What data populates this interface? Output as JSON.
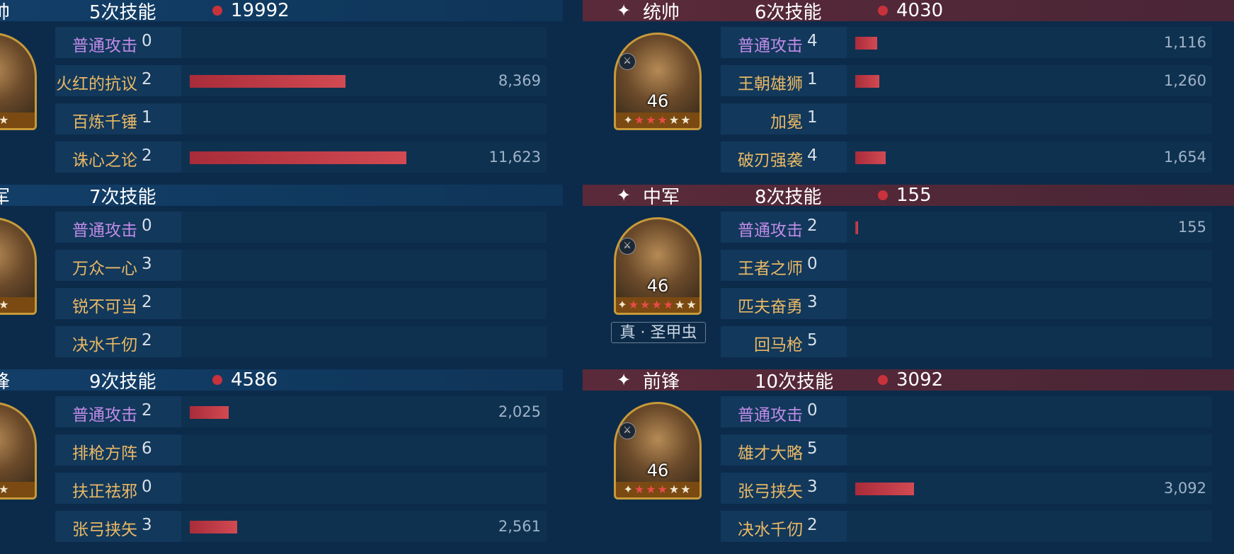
{
  "left": {
    "groups": [
      {
        "role": "帅",
        "count": "5次技能",
        "damage": "19992",
        "show_dot": true,
        "portrait_stars": "★★★",
        "skills": [
          {
            "name": "普通攻击",
            "count": "0",
            "basic": true,
            "damage": "",
            "bar": 0
          },
          {
            "name": "火红的抗议",
            "count": "2",
            "basic": false,
            "damage": "8,369",
            "bar": 0.72
          },
          {
            "name": "百炼千锤",
            "count": "1",
            "basic": false,
            "damage": "",
            "bar": 0
          },
          {
            "name": "诛心之论",
            "count": "2",
            "basic": false,
            "damage": "11,623",
            "bar": 1.0
          }
        ]
      },
      {
        "role": "军",
        "count": "7次技能",
        "damage": "",
        "show_dot": false,
        "portrait_stars": "★★★",
        "skills": [
          {
            "name": "普通攻击",
            "count": "0",
            "basic": true,
            "damage": "",
            "bar": 0
          },
          {
            "name": "万众一心",
            "count": "3",
            "basic": false,
            "damage": "",
            "bar": 0
          },
          {
            "name": "锐不可当",
            "count": "2",
            "basic": false,
            "damage": "",
            "bar": 0
          },
          {
            "name": "决水千仞",
            "count": "2",
            "basic": false,
            "damage": "",
            "bar": 0
          }
        ]
      },
      {
        "role": "锋",
        "count": "9次技能",
        "damage": "4586",
        "show_dot": true,
        "portrait_stars": "★★★",
        "skills": [
          {
            "name": "普通攻击",
            "count": "2",
            "basic": true,
            "damage": "2,025",
            "bar": 0.18
          },
          {
            "name": "排枪方阵",
            "count": "6",
            "basic": false,
            "damage": "",
            "bar": 0
          },
          {
            "name": "扶正祛邪",
            "count": "0",
            "basic": false,
            "damage": "",
            "bar": 0
          },
          {
            "name": "张弓挟矢",
            "count": "3",
            "basic": false,
            "damage": "2,561",
            "bar": 0.22
          }
        ]
      }
    ]
  },
  "right": {
    "groups": [
      {
        "role": "统帅",
        "count": "6次技能",
        "damage": "4030",
        "show_dot": true,
        "level": "46",
        "portrait_stars": "★★★★★",
        "skills": [
          {
            "name": "普通攻击",
            "count": "4",
            "basic": true,
            "damage": "1,116",
            "bar": 0.1
          },
          {
            "name": "王朝雄狮",
            "count": "1",
            "basic": false,
            "damage": "1,260",
            "bar": 0.11
          },
          {
            "name": "加冕",
            "count": "1",
            "basic": false,
            "damage": "",
            "bar": 0
          },
          {
            "name": "破刃强袭",
            "count": "4",
            "basic": false,
            "damage": "1,654",
            "bar": 0.14
          }
        ]
      },
      {
        "role": "中军",
        "count": "8次技能",
        "damage": "155",
        "show_dot": true,
        "level": "46",
        "portrait_stars": "★★★★★★",
        "tag": "真 · 圣甲虫",
        "skills": [
          {
            "name": "普通攻击",
            "count": "2",
            "basic": true,
            "damage": "155",
            "bar": 0.012
          },
          {
            "name": "王者之师",
            "count": "0",
            "basic": false,
            "damage": "",
            "bar": 0
          },
          {
            "name": "匹夫奋勇",
            "count": "3",
            "basic": false,
            "damage": "",
            "bar": 0
          },
          {
            "name": "回马枪",
            "count": "5",
            "basic": false,
            "damage": "",
            "bar": 0
          }
        ]
      },
      {
        "role": "前锋",
        "count": "10次技能",
        "damage": "3092",
        "show_dot": true,
        "level": "46",
        "portrait_stars": "★★★★★",
        "skills": [
          {
            "name": "普通攻击",
            "count": "0",
            "basic": true,
            "damage": "",
            "bar": 0
          },
          {
            "name": "雄才大略",
            "count": "5",
            "basic": false,
            "damage": "",
            "bar": 0
          },
          {
            "name": "张弓挟矢",
            "count": "3",
            "basic": false,
            "damage": "3,092",
            "bar": 0.27
          },
          {
            "name": "决水千仞",
            "count": "2",
            "basic": false,
            "damage": "",
            "bar": 0
          }
        ]
      }
    ]
  },
  "colors": {
    "background": "#0c2b4b",
    "left_header": "#123e68",
    "right_header": "#5a2a3a",
    "skill_basic": "#c08ce8",
    "skill_tactic": "#e9b865",
    "bar": "#c8323c",
    "portrait_frame": "#c79a3a"
  }
}
